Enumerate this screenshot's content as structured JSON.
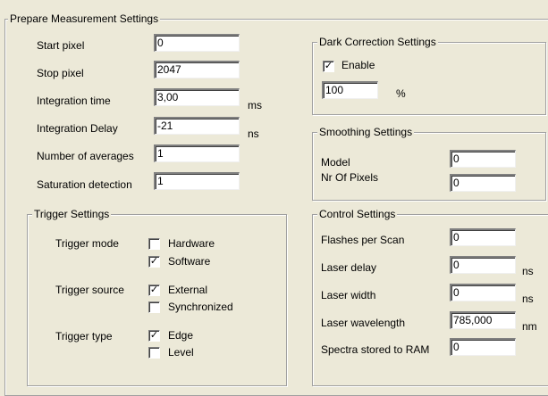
{
  "prepare": {
    "title": "Prepare Measurement Settings",
    "start_pixel": {
      "label": "Start pixel",
      "value": "0"
    },
    "stop_pixel": {
      "label": "Stop pixel",
      "value": "2047"
    },
    "integration_time": {
      "label": "Integration time",
      "value": "3,00",
      "unit": "ms"
    },
    "integration_delay": {
      "label": "Integration Delay",
      "value": "-21",
      "unit": "ns"
    },
    "averages": {
      "label": "Number of averages",
      "value": "1"
    },
    "saturation": {
      "label": "Saturation detection",
      "value": "1"
    }
  },
  "trigger": {
    "title": "Trigger Settings",
    "mode_label": "Trigger mode",
    "hardware": {
      "label": "Hardware",
      "checked": false
    },
    "software": {
      "label": "Software",
      "checked": true
    },
    "source_label": "Trigger source",
    "external": {
      "label": "External",
      "checked": true
    },
    "synchronized": {
      "label": "Synchronized",
      "checked": false
    },
    "type_label": "Trigger type",
    "edge": {
      "label": "Edge",
      "checked": true
    },
    "level": {
      "label": "Level",
      "checked": false
    }
  },
  "dark": {
    "title": "Dark Correction Settings",
    "enable": {
      "label": "Enable",
      "checked": true
    },
    "value": "100",
    "unit": "%"
  },
  "smoothing": {
    "title": "Smoothing Settings",
    "model": {
      "label": "Model",
      "value": "0"
    },
    "pixels": {
      "label": "Nr Of Pixels",
      "value": "0"
    }
  },
  "control": {
    "title": "Control Settings",
    "flashes": {
      "label": "Flashes per Scan",
      "value": "0"
    },
    "laser_delay": {
      "label": "Laser delay",
      "value": "0",
      "unit": "ns"
    },
    "laser_width": {
      "label": "Laser width",
      "value": "0",
      "unit": "ns"
    },
    "laser_wavelength": {
      "label": "Laser wavelength",
      "value": "785,000",
      "unit": "nm"
    },
    "spectra_ram": {
      "label": "Spectra stored to RAM",
      "value": "0"
    }
  },
  "check_mark": "✓"
}
